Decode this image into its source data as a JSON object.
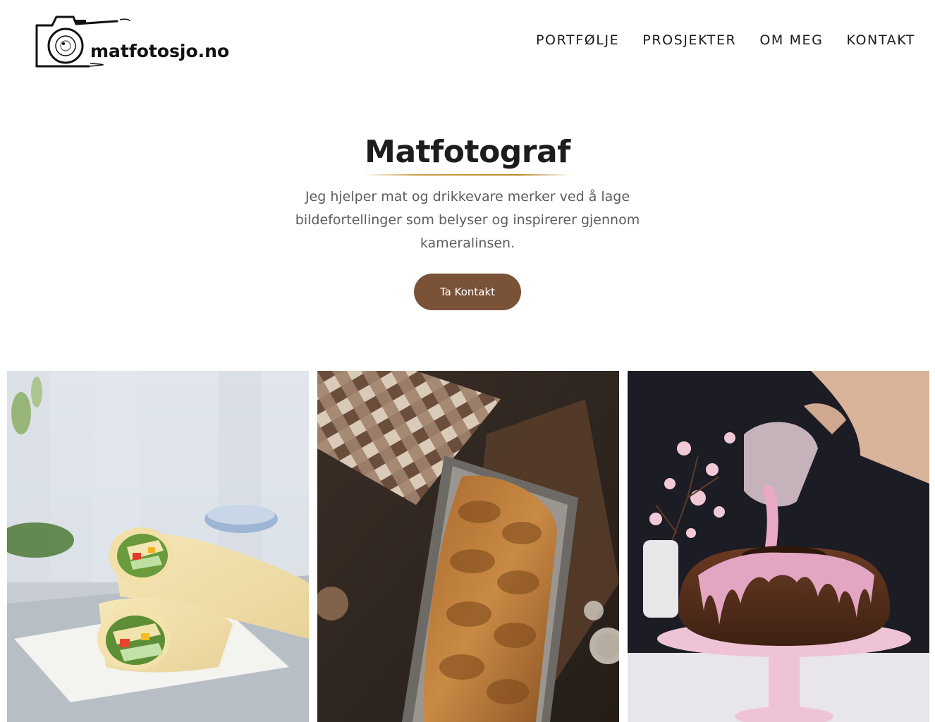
{
  "header": {
    "logo_text": "matfotosjo.no",
    "nav": [
      {
        "label": "PORTFØLJE"
      },
      {
        "label": "PROSJEKTER"
      },
      {
        "label": "OM MEG"
      },
      {
        "label": "KONTAKT"
      }
    ]
  },
  "hero": {
    "title": "Matfotograf",
    "lines": [
      "Jeg hjelper mat og drikkevare merker ved å lage",
      "bildefortellinger som belyser og inspirerer gjennom",
      "kameralinsen."
    ],
    "cta_label": "Ta Kontakt"
  },
  "colors": {
    "accent_button": "#7a5238",
    "title_underline": "#c9a14d"
  },
  "gallery": [
    {
      "subject": "wraps-photo"
    },
    {
      "subject": "braided-bread-photo"
    },
    {
      "subject": "bundt-cake-glaze-photo"
    }
  ]
}
